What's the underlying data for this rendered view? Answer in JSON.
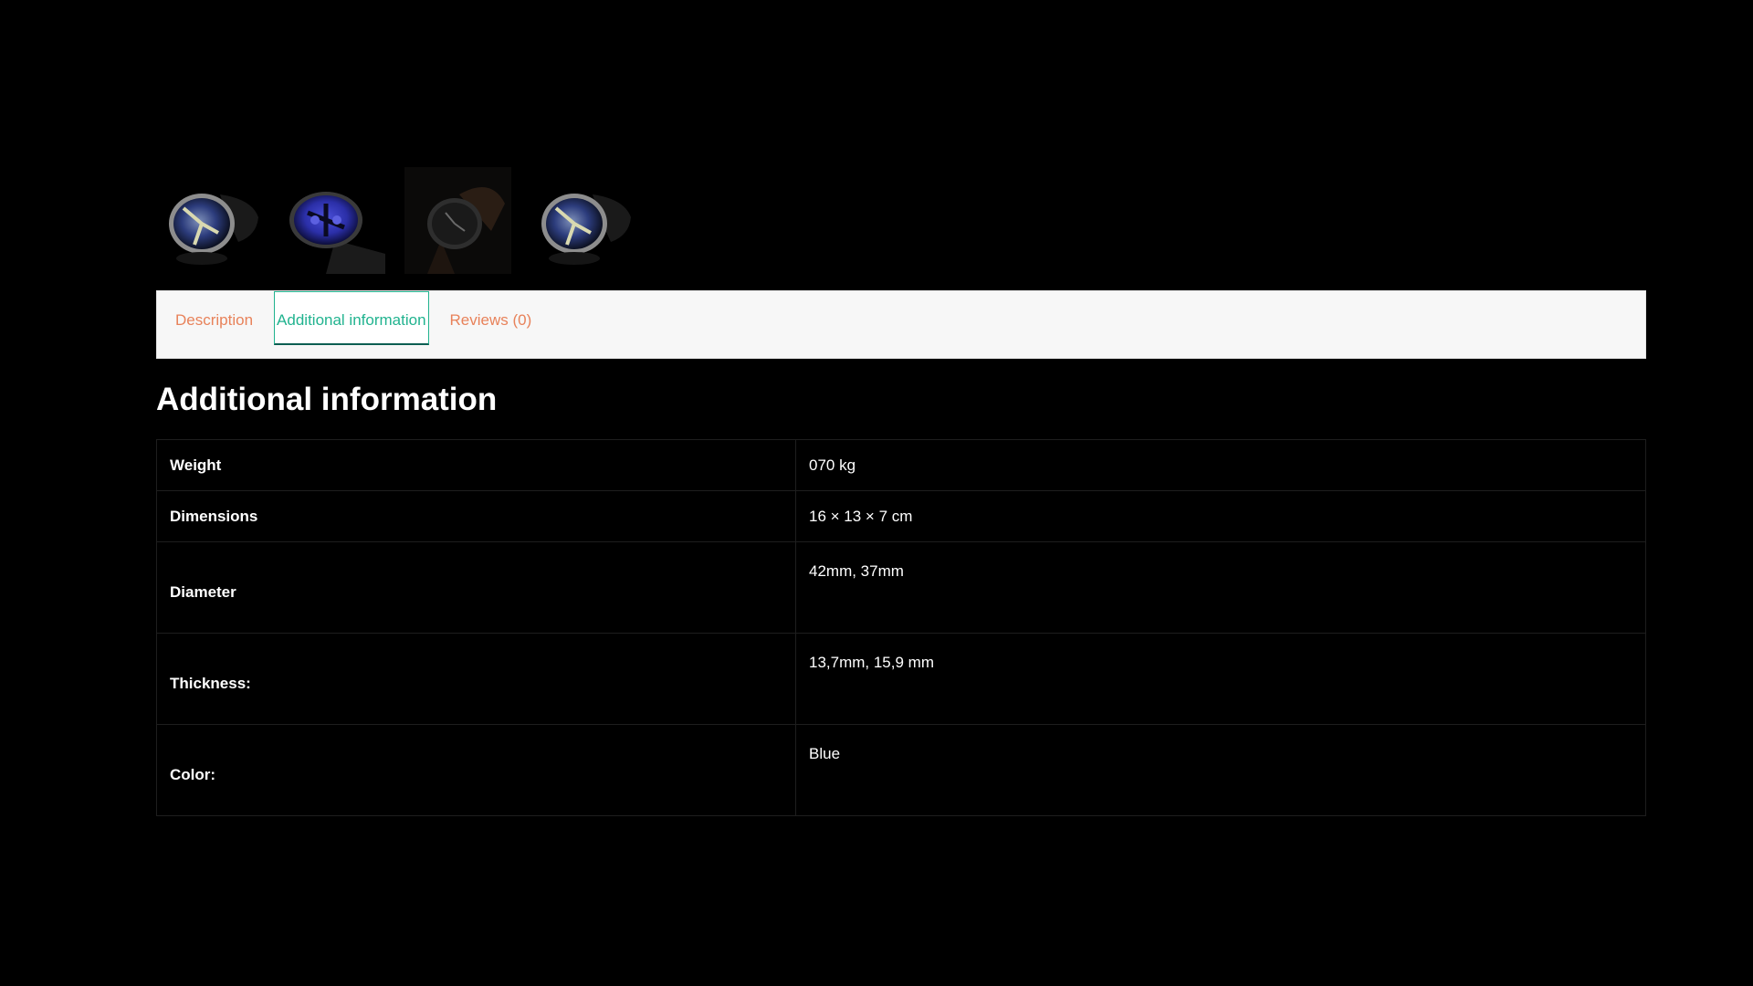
{
  "gallery": {
    "thumbnails": [
      {
        "alt": "watch-thumbnail-1"
      },
      {
        "alt": "watch-thumbnail-2"
      },
      {
        "alt": "watch-thumbnail-3"
      },
      {
        "alt": "watch-thumbnail-4"
      }
    ]
  },
  "tabs": [
    {
      "label": "Description",
      "active": false
    },
    {
      "label": "Additional information",
      "active": true
    },
    {
      "label": "Reviews (0)",
      "active": false
    }
  ],
  "section": {
    "title": "Additional information"
  },
  "attributes": [
    {
      "label": "Weight",
      "value": "070 kg"
    },
    {
      "label": "Dimensions",
      "value": "16 × 13 × 7 cm"
    },
    {
      "label": "Diameter",
      "value": "42mm, 37mm"
    },
    {
      "label": "Thickness:",
      "value": "13,7mm, 15,9 mm"
    },
    {
      "label": "Color:",
      "value": "Blue"
    }
  ],
  "colors": {
    "background": "#000000",
    "tab_inactive": "#e8825a",
    "tab_active": "#21b38f",
    "tab_bar": "#f7f7f7",
    "dial_blue": "#2b2fa8"
  }
}
